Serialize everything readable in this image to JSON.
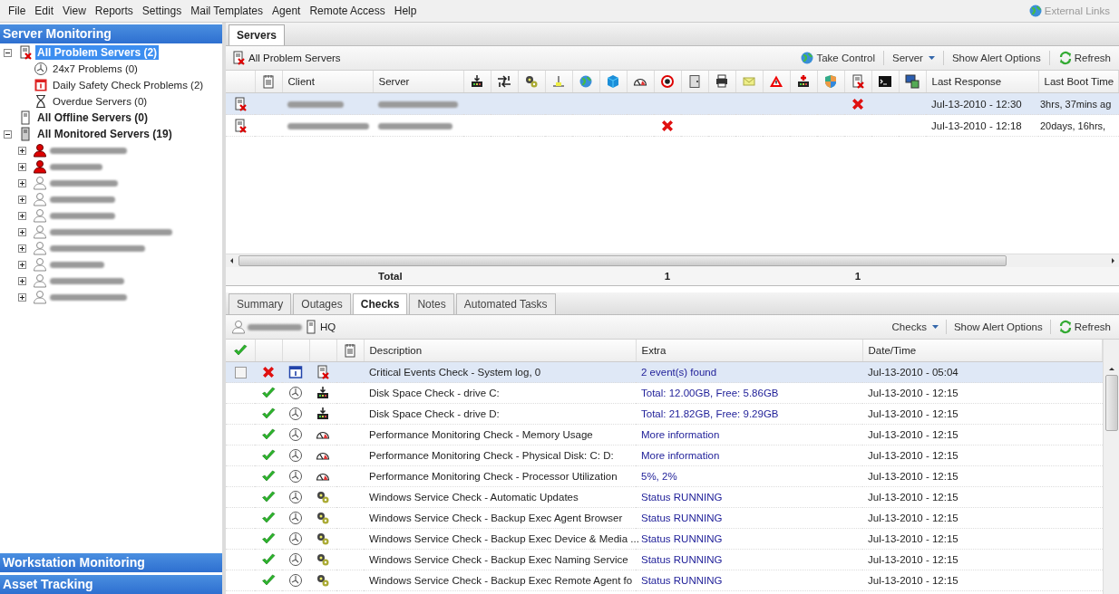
{
  "menu": [
    "File",
    "Edit",
    "View",
    "Reports",
    "Settings",
    "Mail Templates",
    "Agent",
    "Remote Access",
    "Help"
  ],
  "external_links": {
    "label": "External Links",
    "disabled": true
  },
  "sidebar": {
    "title": "Server Monitoring",
    "tree": [
      {
        "label": "All Problem Servers (2)",
        "kind": "server-problem",
        "selected": true,
        "expanded": true,
        "children": [
          {
            "label": "24x7 Problems (0)",
            "kind": "clock",
            "selected": false
          },
          {
            "label": "Daily Safety Check Problems (2)",
            "kind": "calendar",
            "selected": false
          },
          {
            "label": "Overdue Servers (0)",
            "kind": "hourglass",
            "selected": false
          }
        ]
      },
      {
        "label": "All Offline Servers (0)",
        "kind": "server-off",
        "selected": false
      },
      {
        "label": "All Monitored Servers (19)",
        "kind": "server",
        "selected": false,
        "expanded": true,
        "children": [
          {
            "kind": "client",
            "alert": true,
            "expanded": false,
            "selected": false
          },
          {
            "kind": "client",
            "alert": true,
            "expanded": false,
            "selected": false
          },
          {
            "kind": "client",
            "alert": false,
            "expanded": false,
            "selected": false
          },
          {
            "kind": "client",
            "alert": false,
            "expanded": false,
            "selected": false
          },
          {
            "kind": "client",
            "alert": false,
            "expanded": false,
            "selected": false
          },
          {
            "kind": "client",
            "alert": false,
            "expanded": false,
            "selected": false
          },
          {
            "kind": "client",
            "alert": false,
            "expanded": false,
            "selected": false
          },
          {
            "kind": "client",
            "alert": false,
            "expanded": false,
            "selected": false
          },
          {
            "kind": "client",
            "alert": false,
            "expanded": false,
            "selected": false
          },
          {
            "kind": "client",
            "alert": false,
            "expanded": false,
            "selected": false
          }
        ]
      }
    ]
  },
  "bottom_sections": [
    "Workstation Monitoring",
    "Asset Tracking"
  ],
  "main_tabs": [
    {
      "label": "Servers",
      "selected": true
    }
  ],
  "servers_toolbar": {
    "title": "All Problem Servers",
    "actions": [
      {
        "label": "Take Control",
        "kind": "remote"
      },
      {
        "label": "Server",
        "kind": "menu"
      },
      {
        "label": "Show Alert Options",
        "kind": "plain"
      },
      {
        "label": "Refresh",
        "kind": "refresh"
      }
    ]
  },
  "servers_table": {
    "columns": [
      "Client",
      "Server"
    ],
    "check_columns": [
      {
        "kind": "disk"
      },
      {
        "kind": "transfer"
      },
      {
        "kind": "services"
      },
      {
        "kind": "network"
      },
      {
        "kind": "globe"
      },
      {
        "kind": "cube"
      },
      {
        "kind": "gauge"
      },
      {
        "kind": "virus",
        "total": "1"
      },
      {
        "kind": "door"
      },
      {
        "kind": "printer"
      },
      {
        "kind": "mail"
      },
      {
        "kind": "warning"
      },
      {
        "kind": "disk-add"
      },
      {
        "kind": "shield"
      },
      {
        "kind": "eventlog",
        "total": "1"
      },
      {
        "kind": "terminal"
      },
      {
        "kind": "computer"
      }
    ],
    "time_columns": [
      "Last Response",
      "Last Boot Time"
    ],
    "rows": [
      {
        "selected": true,
        "failures": [
          {
            "kind": "eventlog"
          }
        ],
        "last_response": "Jul-13-2010 - 12:30",
        "last_boot": "3hrs, 37mins ag"
      },
      {
        "selected": false,
        "failures": [
          {
            "kind": "virus"
          }
        ],
        "last_response": "Jul-13-2010 - 12:18",
        "last_boot": "20days, 16hrs,"
      }
    ],
    "total": {
      "label": "Total"
    }
  },
  "detail_tabs": [
    {
      "label": "Summary",
      "selected": false
    },
    {
      "label": "Outages",
      "selected": false
    },
    {
      "label": "Checks",
      "selected": true
    },
    {
      "label": "Notes",
      "selected": false
    },
    {
      "label": "Automated Tasks",
      "selected": false
    }
  ],
  "checks_toolbar": {
    "site": "HQ",
    "actions": [
      {
        "label": "Checks",
        "kind": "menu"
      },
      {
        "label": "Show Alert Options",
        "kind": "plain"
      },
      {
        "label": "Refresh",
        "kind": "refresh"
      }
    ]
  },
  "checks_table": {
    "columns": [
      "Description",
      "Extra",
      "Date/Time"
    ],
    "rows": [
      {
        "selected": true,
        "checkbox": {
          "checked": false
        },
        "status": {
          "kind": "failed"
        },
        "schedule": {
          "kind": "daily"
        },
        "type": {
          "kind": "eventlog"
        },
        "description": "Critical Events Check - System log, 0",
        "extra": "2 event(s) found",
        "datetime": "Jul-13-2010 - 05:04"
      },
      {
        "selected": false,
        "status": {
          "kind": "ok"
        },
        "schedule": {
          "kind": "continuous"
        },
        "type": {
          "kind": "disk"
        },
        "description": "Disk Space Check - drive C:",
        "extra": "Total: 12.00GB, Free: 5.86GB",
        "datetime": "Jul-13-2010 - 12:15"
      },
      {
        "selected": false,
        "status": {
          "kind": "ok"
        },
        "schedule": {
          "kind": "continuous"
        },
        "type": {
          "kind": "disk"
        },
        "description": "Disk Space Check - drive D:",
        "extra": "Total: 21.82GB, Free: 9.29GB",
        "datetime": "Jul-13-2010 - 12:15"
      },
      {
        "selected": false,
        "status": {
          "kind": "ok"
        },
        "schedule": {
          "kind": "continuous"
        },
        "type": {
          "kind": "gauge"
        },
        "description": "Performance Monitoring Check - Memory Usage",
        "extra": "More information",
        "datetime": "Jul-13-2010 - 12:15"
      },
      {
        "selected": false,
        "status": {
          "kind": "ok"
        },
        "schedule": {
          "kind": "continuous"
        },
        "type": {
          "kind": "gauge"
        },
        "description": "Performance Monitoring Check - Physical Disk: C: D:",
        "extra": "More information",
        "datetime": "Jul-13-2010 - 12:15"
      },
      {
        "selected": false,
        "status": {
          "kind": "ok"
        },
        "schedule": {
          "kind": "continuous"
        },
        "type": {
          "kind": "gauge"
        },
        "description": "Performance Monitoring Check - Processor Utilization",
        "extra": "5%, 2%",
        "datetime": "Jul-13-2010 - 12:15"
      },
      {
        "selected": false,
        "status": {
          "kind": "ok"
        },
        "schedule": {
          "kind": "continuous"
        },
        "type": {
          "kind": "services"
        },
        "description": "Windows Service Check - Automatic Updates",
        "extra": "Status RUNNING",
        "datetime": "Jul-13-2010 - 12:15"
      },
      {
        "selected": false,
        "status": {
          "kind": "ok"
        },
        "schedule": {
          "kind": "continuous"
        },
        "type": {
          "kind": "services"
        },
        "description": "Windows Service Check - Backup Exec Agent Browser",
        "extra": "Status RUNNING",
        "datetime": "Jul-13-2010 - 12:15"
      },
      {
        "selected": false,
        "status": {
          "kind": "ok"
        },
        "schedule": {
          "kind": "continuous"
        },
        "type": {
          "kind": "services"
        },
        "description": "Windows Service Check - Backup Exec Device & Media ...",
        "extra": "Status RUNNING",
        "datetime": "Jul-13-2010 - 12:15"
      },
      {
        "selected": false,
        "status": {
          "kind": "ok"
        },
        "schedule": {
          "kind": "continuous"
        },
        "type": {
          "kind": "services"
        },
        "description": "Windows Service Check - Backup Exec Naming Service",
        "extra": "Status RUNNING",
        "datetime": "Jul-13-2010 - 12:15"
      },
      {
        "selected": false,
        "status": {
          "kind": "ok"
        },
        "schedule": {
          "kind": "continuous"
        },
        "type": {
          "kind": "services"
        },
        "description": "Windows Service Check - Backup Exec Remote Agent fo",
        "extra": "Status RUNNING",
        "datetime": "Jul-13-2010 - 12:15"
      }
    ]
  }
}
